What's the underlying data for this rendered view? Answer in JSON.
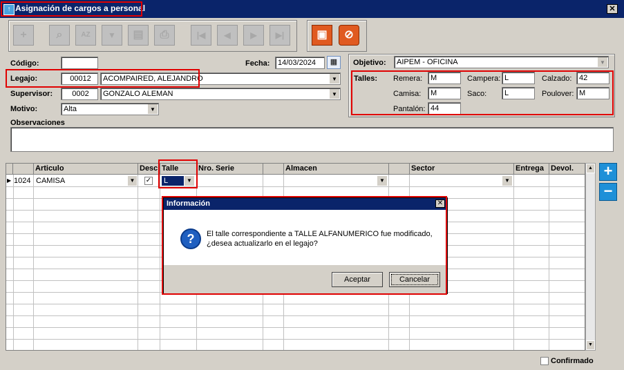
{
  "window": {
    "title": "Asignación de cargos a personal",
    "close_glyph": "✕"
  },
  "toolbar": {
    "buttons": [
      {
        "icon": "add-icon",
        "glyph": "+"
      },
      {
        "icon": "search-icon",
        "glyph": "⌕"
      },
      {
        "icon": "sort-icon",
        "glyph": "AZ"
      },
      {
        "icon": "filter-icon",
        "glyph": "▼"
      },
      {
        "icon": "report-icon",
        "glyph": "▤"
      },
      {
        "icon": "print-icon",
        "glyph": "⎙"
      },
      {
        "icon": "first-icon",
        "glyph": "|◀"
      },
      {
        "icon": "prev-icon",
        "glyph": "◀"
      },
      {
        "icon": "next-icon",
        "glyph": "▶"
      },
      {
        "icon": "last-icon",
        "glyph": "▶|"
      }
    ],
    "save_glyph": "▣",
    "cancel_glyph": "⊘"
  },
  "form": {
    "codigo_label": "Código:",
    "codigo_value": "",
    "fecha_label": "Fecha:",
    "fecha_value": "14/03/2024",
    "legajo_label": "Legajo:",
    "legajo_code": "00012",
    "legajo_name": "ACOMPAIRED, ALEJANDRO",
    "supervisor_label": "Supervisor:",
    "supervisor_code": "0002",
    "supervisor_name": "GONZALO ALEMAN",
    "motivo_label": "Motivo:",
    "motivo_value": "Alta",
    "observaciones_label": "Observaciones",
    "objetivo_label": "Objetivo:",
    "objetivo_value": "AIPEM - OFICINA",
    "talles_label": "Talles:",
    "talles": {
      "remera_label": "Remera:",
      "remera": "M",
      "campera_label": "Campera:",
      "campera": "L",
      "calzado_label": "Calzado:",
      "calzado": "42",
      "camisa_label": "Camisa:",
      "camisa": "M",
      "saco_label": "Saco:",
      "saco": "L",
      "poulover_label": "Poulover:",
      "poulover": "M",
      "pantalon_label": "Pantalón:",
      "pantalon": "44"
    }
  },
  "grid": {
    "columns": [
      "Articulo",
      "Desc.",
      "Talle",
      "Nro. Serie",
      "Almacen",
      "Sector",
      "Entrega",
      "Devol."
    ],
    "row": {
      "code": "1024",
      "articulo": "CAMISA",
      "desc_checked": "✓",
      "talle": "L"
    }
  },
  "dialog": {
    "title": "Información",
    "message_line1": "El talle correspondiente a TALLE ALFANUMERICO fue modificado,",
    "message_line2": "¿desea actualizarlo en el legajo?",
    "icon_glyph": "?",
    "accept": "Aceptar",
    "cancel": "Cancelar"
  },
  "footer": {
    "confirmado_label": "Confirmado"
  },
  "colors": {
    "title_bar": "#0a246a",
    "highlight": "#e00000",
    "panel": "#d4d0c8"
  }
}
